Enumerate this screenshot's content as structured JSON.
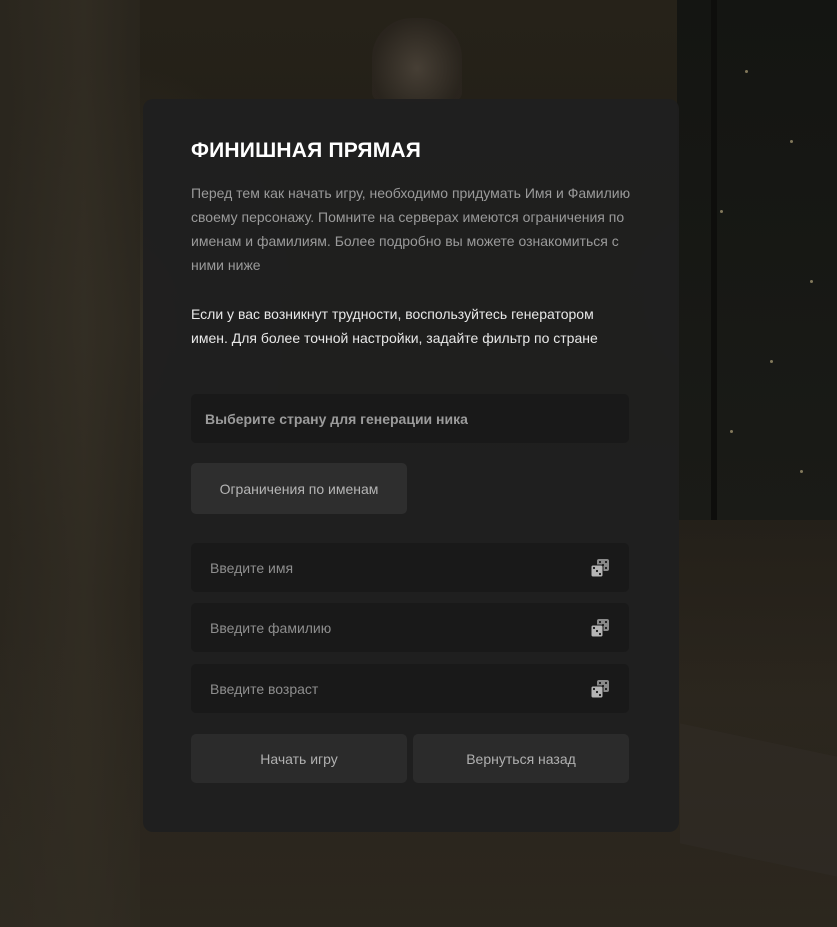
{
  "form": {
    "title": "ФИНИШНАЯ ПРЯМАЯ",
    "description": "Перед тем как начать игру, необходимо придумать Имя и Фамилию своему персонажу. Помните на серверах имеются ограничения по именам и фамилиям. Более подробно вы можете ознакомиться с ними ниже",
    "hint": "Если у вас возникнут трудности, воспользуйтесь генератором имен. Для более точной настройки, задайте фильтр по стране",
    "country_select": {
      "placeholder": "Выберите страну для генерации ника"
    },
    "restrictions_button": "Ограничения по именам",
    "fields": {
      "name": {
        "value": "",
        "placeholder": "Введите имя",
        "icon": "dice-icon"
      },
      "surname": {
        "value": "",
        "placeholder": "Введите фамилию",
        "icon": "dice-icon"
      },
      "age": {
        "value": "",
        "placeholder": "Введите возраст",
        "icon": "dice-icon"
      }
    },
    "start_button": "Начать игру",
    "back_button": "Вернуться назад"
  },
  "colors": {
    "panel": "#1f1f1f",
    "field": "#191919",
    "button": "#2b2b2b",
    "title": "#ffffff",
    "muted_text": "#9a9a9a"
  }
}
